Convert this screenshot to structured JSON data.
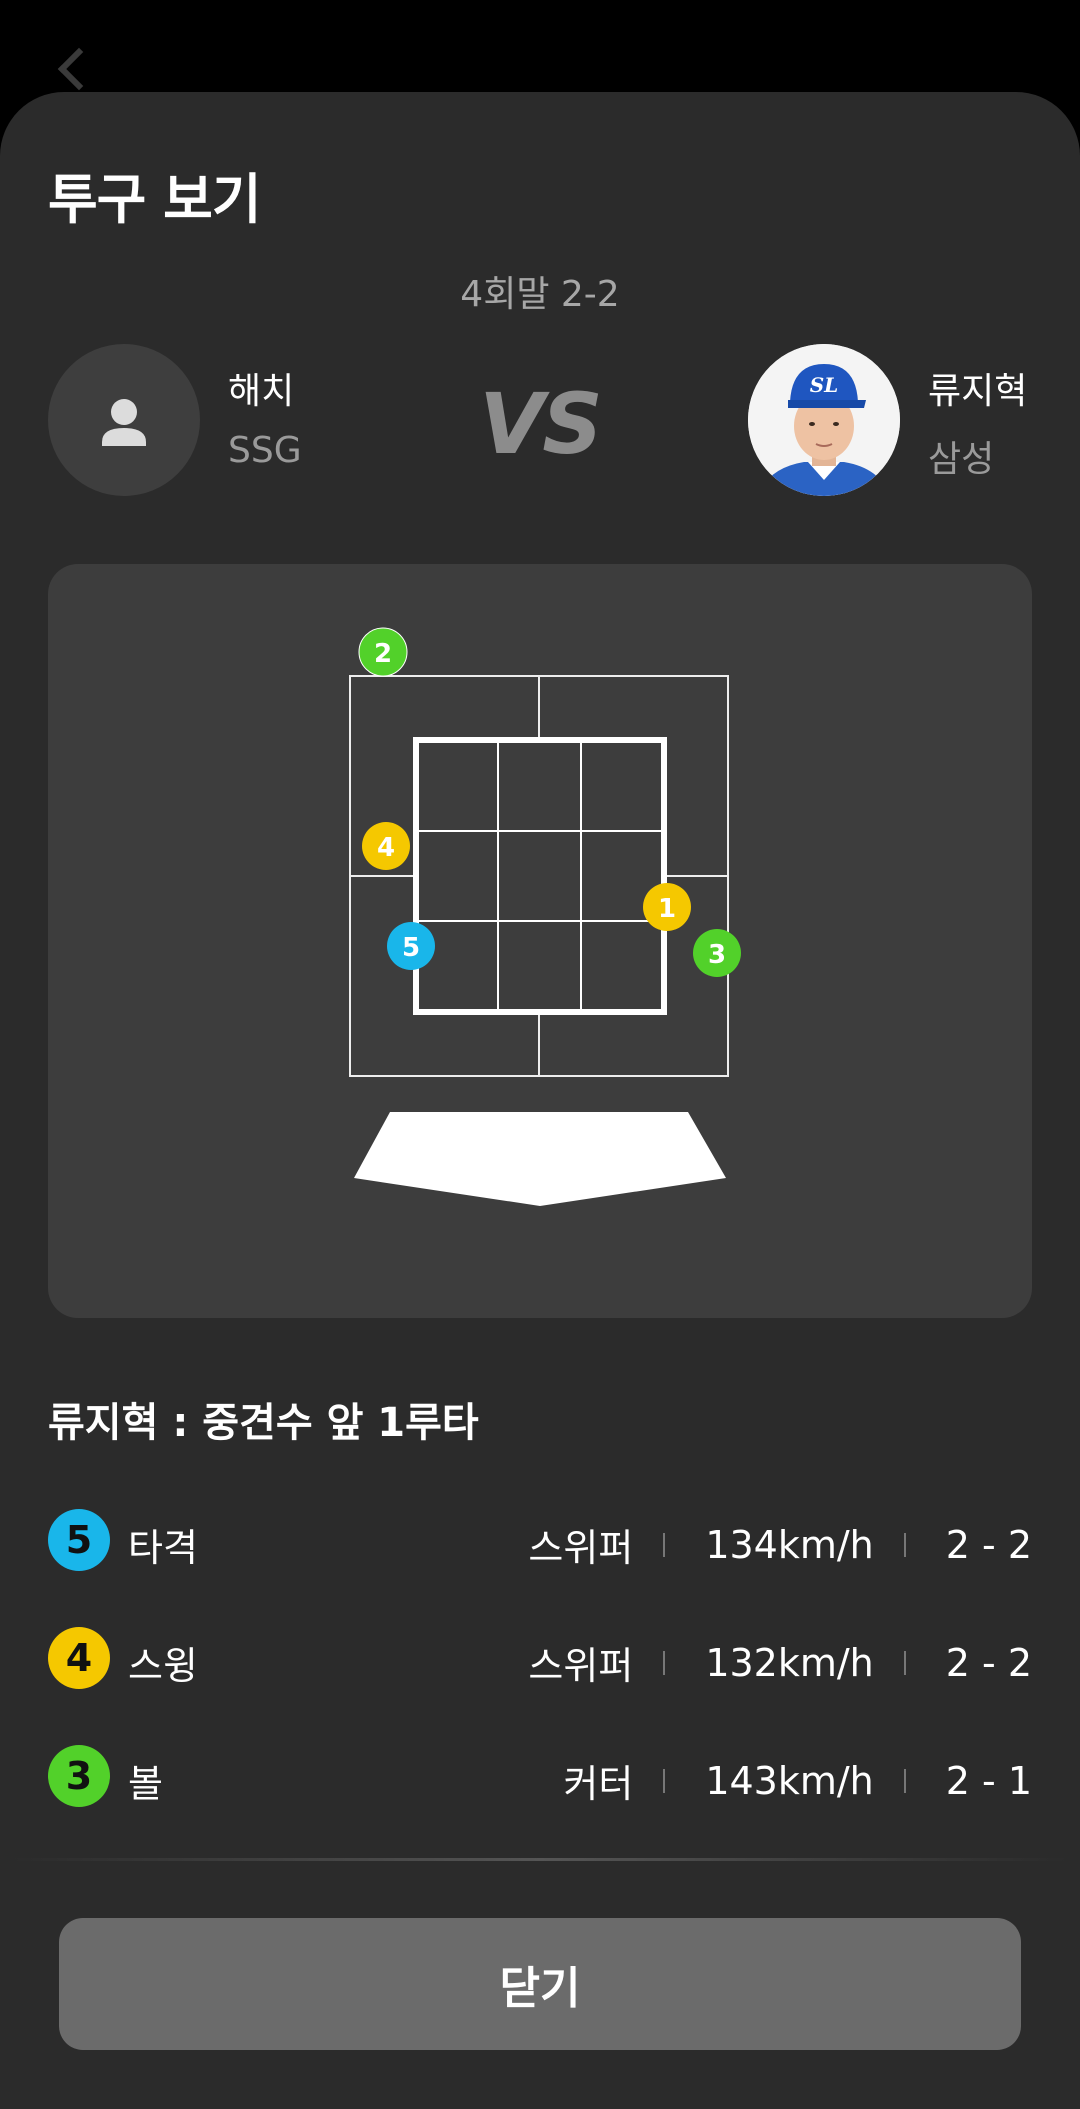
{
  "sheet": {
    "title": "투구 보기",
    "inning": "4회말 2-2"
  },
  "batter_left": {
    "name": "해치",
    "team": "SSG",
    "avatar_icon": "person-icon"
  },
  "vs_label": "VS",
  "batter_right": {
    "name": "류지혁",
    "team": "삼성",
    "avatar_icon": "player-photo",
    "cap_text": "SL"
  },
  "pitch_markers": [
    {
      "num": "1",
      "color": "#f5c800"
    },
    {
      "num": "2",
      "color": "#52d12a"
    },
    {
      "num": "3",
      "color": "#52d12a"
    },
    {
      "num": "4",
      "color": "#f5c800"
    },
    {
      "num": "5",
      "color": "#19b6ea"
    }
  ],
  "result": {
    "title": "류지혁 : 중견수 앞 1루타"
  },
  "pitches": [
    {
      "num": "5",
      "label": "타격",
      "type": "스위퍼",
      "speed": "134km/h",
      "count": "2 - 2",
      "color": "#19b6ea"
    },
    {
      "num": "4",
      "label": "스윙",
      "type": "스위퍼",
      "speed": "132km/h",
      "count": "2 - 2",
      "color": "#f5c800"
    },
    {
      "num": "3",
      "label": "볼",
      "type": "커터",
      "speed": "143km/h",
      "count": "2 - 1",
      "color": "#52d12a"
    }
  ],
  "close_button": "닫기"
}
